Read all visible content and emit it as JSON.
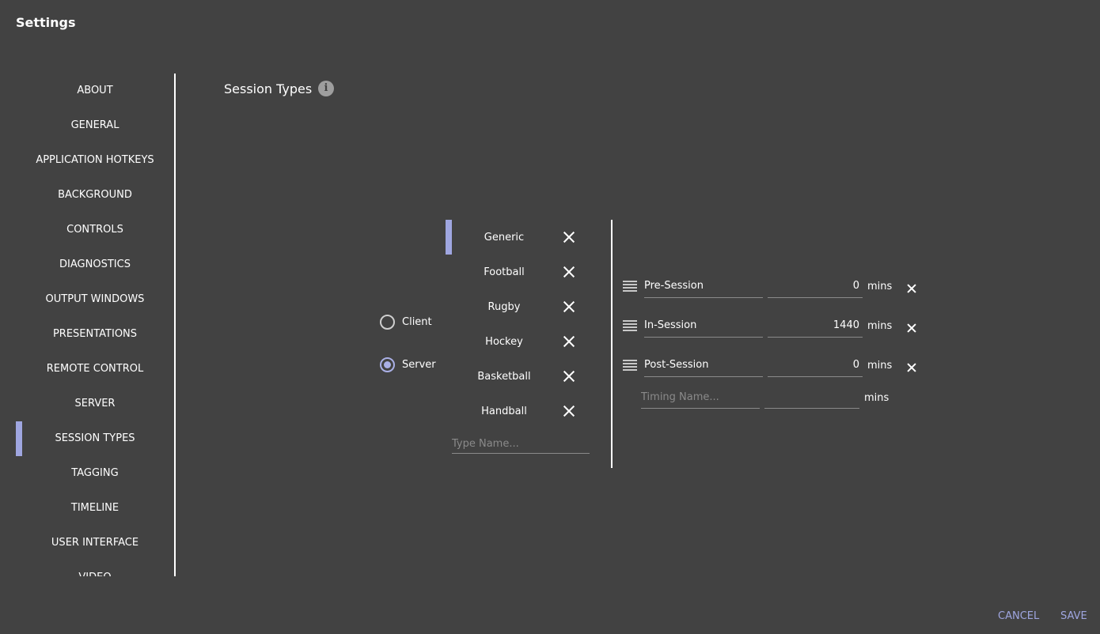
{
  "window": {
    "title": "Settings"
  },
  "sidebar": {
    "items": [
      {
        "label": "ABOUT"
      },
      {
        "label": "GENERAL"
      },
      {
        "label": "APPLICATION HOTKEYS"
      },
      {
        "label": "BACKGROUND"
      },
      {
        "label": "CONTROLS"
      },
      {
        "label": "DIAGNOSTICS"
      },
      {
        "label": "OUTPUT WINDOWS"
      },
      {
        "label": "PRESENTATIONS"
      },
      {
        "label": "REMOTE CONTROL"
      },
      {
        "label": "SERVER"
      },
      {
        "label": "SESSION TYPES",
        "active": true
      },
      {
        "label": "TAGGING"
      },
      {
        "label": "TIMELINE"
      },
      {
        "label": "USER INTERFACE"
      },
      {
        "label": "VIDEO"
      }
    ]
  },
  "main": {
    "title": "Session Types",
    "info_icon": "i",
    "mode": {
      "options": [
        {
          "label": "Client",
          "selected": false
        },
        {
          "label": "Server",
          "selected": true
        }
      ]
    },
    "session_types": [
      {
        "name": "Generic",
        "active": true
      },
      {
        "name": "Football"
      },
      {
        "name": "Rugby"
      },
      {
        "name": "Hockey"
      },
      {
        "name": "Basketball"
      },
      {
        "name": "Handball"
      }
    ],
    "new_type_placeholder": "Type Name...",
    "timings": [
      {
        "name": "Pre-Session",
        "value": "0",
        "unit": "mins"
      },
      {
        "name": "In-Session",
        "value": "1440",
        "unit": "mins"
      },
      {
        "name": "Post-Session",
        "value": "0",
        "unit": "mins"
      }
    ],
    "new_timing": {
      "name_placeholder": "Timing Name...",
      "value_placeholder": "",
      "unit": "mins"
    }
  },
  "footer": {
    "cancel_label": "CANCEL",
    "save_label": "SAVE"
  },
  "colors": {
    "background": "#424242",
    "accent": "#9fa6e0",
    "text": "#ffffff"
  }
}
